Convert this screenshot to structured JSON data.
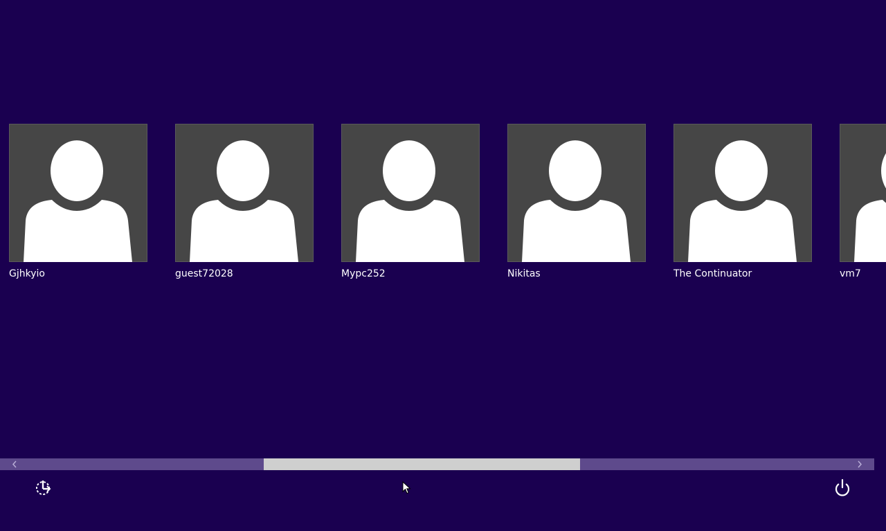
{
  "screen": {
    "background": "#1a0050",
    "accent": "#5e4a8c"
  },
  "users": [
    {
      "name": "Gjhkyio",
      "icon": "user-silhouette-icon"
    },
    {
      "name": "guest72028",
      "icon": "user-silhouette-icon"
    },
    {
      "name": "Mypc252",
      "icon": "user-silhouette-icon"
    },
    {
      "name": "Nikitas",
      "icon": "user-silhouette-icon"
    },
    {
      "name": "The Continuator",
      "icon": "user-silhouette-icon"
    },
    {
      "name": "vm7",
      "icon": "user-silhouette-icon"
    }
  ],
  "scrollbar": {
    "position": 0.47,
    "visible_fraction": 0.38,
    "left_arrow_icon": "chevron-left-icon",
    "right_arrow_icon": "chevron-right-icon"
  },
  "bottom_bar": {
    "ease_of_access_icon": "ease-of-access-icon",
    "power_icon": "power-icon"
  }
}
